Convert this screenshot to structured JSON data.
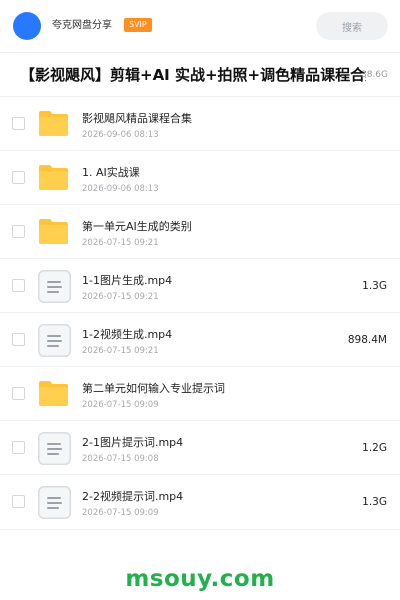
{
  "header": {
    "user_name": "夸克网盘分享",
    "badge": "SVIP",
    "search_placeholder": "搜索"
  },
  "title": "【影视飓风】剪辑+AI 实战+拍照+调色精品课程合集",
  "total_size": "38.6G",
  "files": [
    {
      "type": "folder",
      "name": "影视飓风精品课程合集",
      "date": "2026-09-06 08:13",
      "size": ""
    },
    {
      "type": "folder",
      "name": "1. AI实战课",
      "date": "2026-09-06 08:13",
      "size": ""
    },
    {
      "type": "folder",
      "name": "第一单元AI生成的类别",
      "date": "2026-07-15 09:21",
      "size": ""
    },
    {
      "type": "file",
      "name": "1-1图片生成.mp4",
      "date": "2026-07-15 09:21",
      "size": "1.3G"
    },
    {
      "type": "file",
      "name": "1-2视频生成.mp4",
      "date": "2026-07-15 09:21",
      "size": "898.4M"
    },
    {
      "type": "folder",
      "name": "第二单元如何输入专业提示词",
      "date": "2026-07-15 09:09",
      "size": ""
    },
    {
      "type": "file",
      "name": "2-1图片提示词.mp4",
      "date": "2026-07-15 09:08",
      "size": "1.2G"
    },
    {
      "type": "file",
      "name": "2-2视频提示词.mp4",
      "date": "2026-07-15 09:09",
      "size": "1.3G"
    }
  ],
  "watermark": "msouy.com",
  "colors": {
    "avatar": "#2979ff",
    "badge": "#ff8f1f",
    "folder": "#ffc43a",
    "watermark": "#22b14c"
  }
}
